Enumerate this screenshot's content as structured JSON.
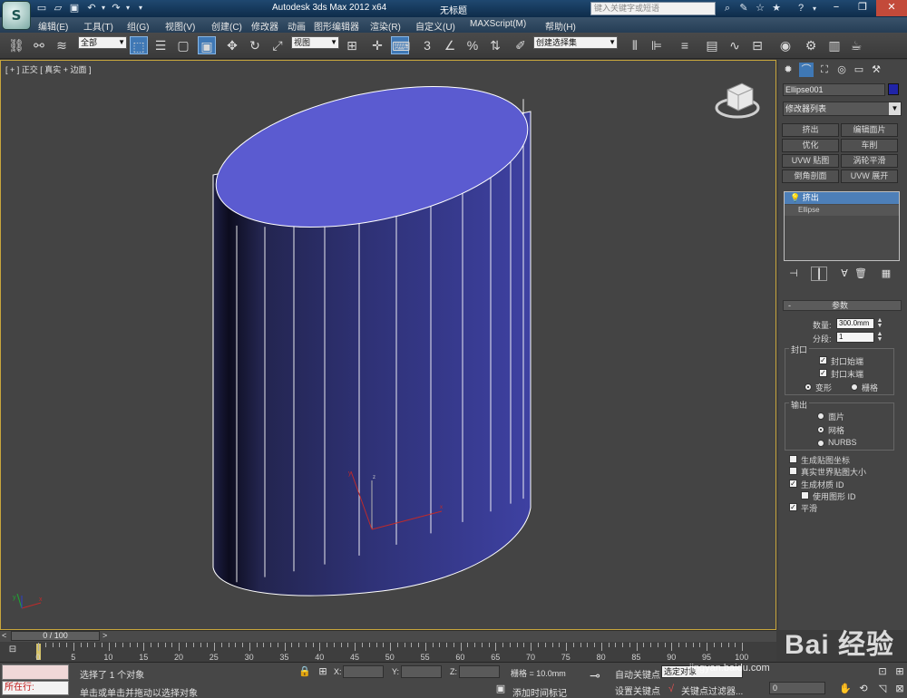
{
  "titlebar": {
    "title": "Autodesk 3ds Max  2012 x64",
    "document": "无标题",
    "search_placeholder": "键入关键字或短语",
    "help": "?"
  },
  "menu": {
    "items": [
      "编辑(E)",
      "工具(T)",
      "组(G)",
      "视图(V)",
      "创建(C)",
      "修改器",
      "动画",
      "图形编辑器",
      "渲染(R)",
      "自定义(U)",
      "MAXScript(M)",
      "帮助(H)"
    ]
  },
  "toolbar": {
    "selection_filter": "全部",
    "reference_coord": "视图",
    "snap_3": "3",
    "named_selection": "创建选择集",
    "select_icon": "select-object-icon",
    "move_icon": "move-icon",
    "rotate_icon": "rotate-icon",
    "scale_icon": "scale-icon"
  },
  "viewport": {
    "label": "[ + ] 正交 [ 真实 + 边面 ]",
    "object_color": "#5b5bd0"
  },
  "command_panel": {
    "object_name": "Ellipse001",
    "object_swatch": "#2024a8",
    "modifier_list": "修改器列表",
    "modifier_buttons": [
      "挤出",
      "编辑面片",
      "优化",
      "车削",
      "UVW 贴图",
      "涡轮平滑",
      "倒角剖面",
      "UVW 展开"
    ],
    "stack": {
      "selected": "挤出",
      "base": "Ellipse"
    },
    "params": {
      "rollout_title": "参数",
      "collapse": "-",
      "amount_label": "数量:",
      "amount_value": "300.0mm",
      "segments_label": "分段:",
      "segments_value": "1",
      "capping_group": "封口",
      "cap_start": "封口始端",
      "cap_end": "封口末端",
      "morph": "变形",
      "grid": "栅格",
      "output_group": "输出",
      "out_patch": "面片",
      "out_mesh": "网格",
      "out_nurbs": "NURBS",
      "gen_mapping": "生成贴图坐标",
      "real_world": "真实世界贴图大小",
      "gen_matid": "生成材质 ID",
      "use_shape_ids": "使用图形 ID",
      "smooth": "平滑"
    }
  },
  "timeline": {
    "frame_display": "0 / 100",
    "ticks": [
      "0",
      "5",
      "10",
      "15",
      "20",
      "25",
      "30",
      "35",
      "40",
      "45",
      "50",
      "55",
      "60",
      "65",
      "70",
      "75",
      "80",
      "85",
      "90",
      "95",
      "100"
    ]
  },
  "statusbar": {
    "listener_label": "所在行:",
    "status_line1": "选择了 1 个对象",
    "status_line2": "单击或单击并拖动以选择对象",
    "x_label": "X:",
    "y_label": "Y:",
    "z_label": "Z:",
    "grid": "栅格 = 10.0mm",
    "add_time_tag": "添加时间标记",
    "auto_key": "自动关键点",
    "set_key": "设置关键点",
    "selected_dropdown": "选定对象",
    "key_filters": "关键点过滤器...",
    "frame_value": "0"
  },
  "watermark": {
    "brand": "Bai 经验",
    "url": "jingyan.baidu.com"
  }
}
